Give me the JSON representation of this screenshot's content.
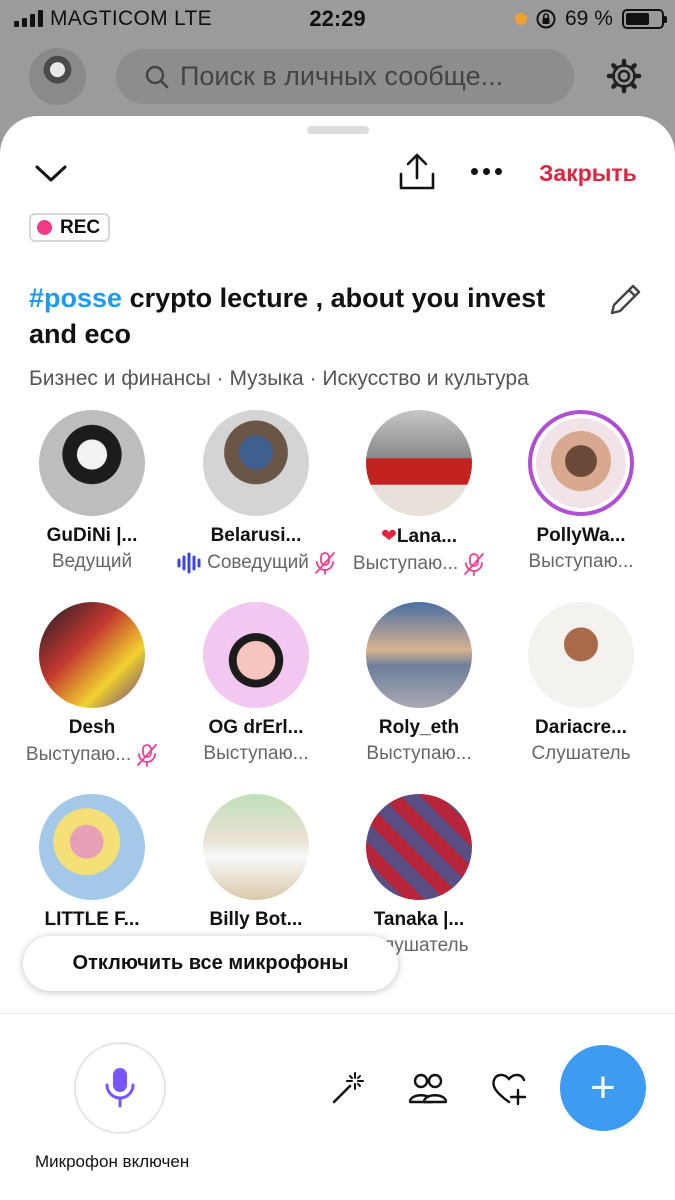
{
  "status_bar": {
    "carrier": "MAGTICOM  LTE",
    "time": "22:29",
    "battery_percent": "69 %",
    "battery_level": 0.69
  },
  "header": {
    "search_placeholder": "Поиск в личных сообще..."
  },
  "space": {
    "close_label": "Закрыть",
    "rec_label": "REC",
    "title_hashtag": "#posse",
    "title_text": " crypto lecture , about you invest and eco",
    "topics": "Бизнес и финансы · Музыка · Искусство и культура"
  },
  "participants": [
    {
      "name": "GuDiNi |...",
      "role": "Ведущий",
      "speaking": false,
      "muted": false,
      "heart": false
    },
    {
      "name": "Belarusi...",
      "role": "Соведущий",
      "speaking": true,
      "muted": true,
      "heart": false
    },
    {
      "name": "Lana...",
      "role": "Выступаю...",
      "speaking": false,
      "muted": true,
      "heart": true
    },
    {
      "name": "PollyWa...",
      "role": "Выступаю...",
      "speaking": false,
      "muted": false,
      "heart": false
    },
    {
      "name": "Desh",
      "role": "Выступаю...",
      "speaking": false,
      "muted": true,
      "heart": false
    },
    {
      "name": "OG drErl...",
      "role": "Выступаю...",
      "speaking": false,
      "muted": false,
      "heart": false
    },
    {
      "name": "Roly_eth",
      "role": "Выступаю...",
      "speaking": false,
      "muted": false,
      "heart": false
    },
    {
      "name": "Dariacre...",
      "role": "Слушатель",
      "speaking": false,
      "muted": false,
      "heart": false
    },
    {
      "name": "LITTLE F...",
      "role": "",
      "speaking": false,
      "muted": false,
      "heart": false
    },
    {
      "name": "Billy Bot...",
      "role": "",
      "speaking": false,
      "muted": false,
      "heart": false
    },
    {
      "name": "Tanaka |...",
      "role": "Слушатель",
      "speaking": false,
      "muted": false,
      "heart": false
    }
  ],
  "mute_all_label": "Отключить все микрофоны",
  "bottom_bar": {
    "mic_label": "Микрофон включен",
    "fab_symbol": "+"
  },
  "colors": {
    "accent_red": "#e0243f",
    "hashtag_blue": "#1d9bf0",
    "rec_pink": "#f23b86",
    "mic_purple": "#7856ff",
    "fab_blue": "#3d9bf2"
  }
}
